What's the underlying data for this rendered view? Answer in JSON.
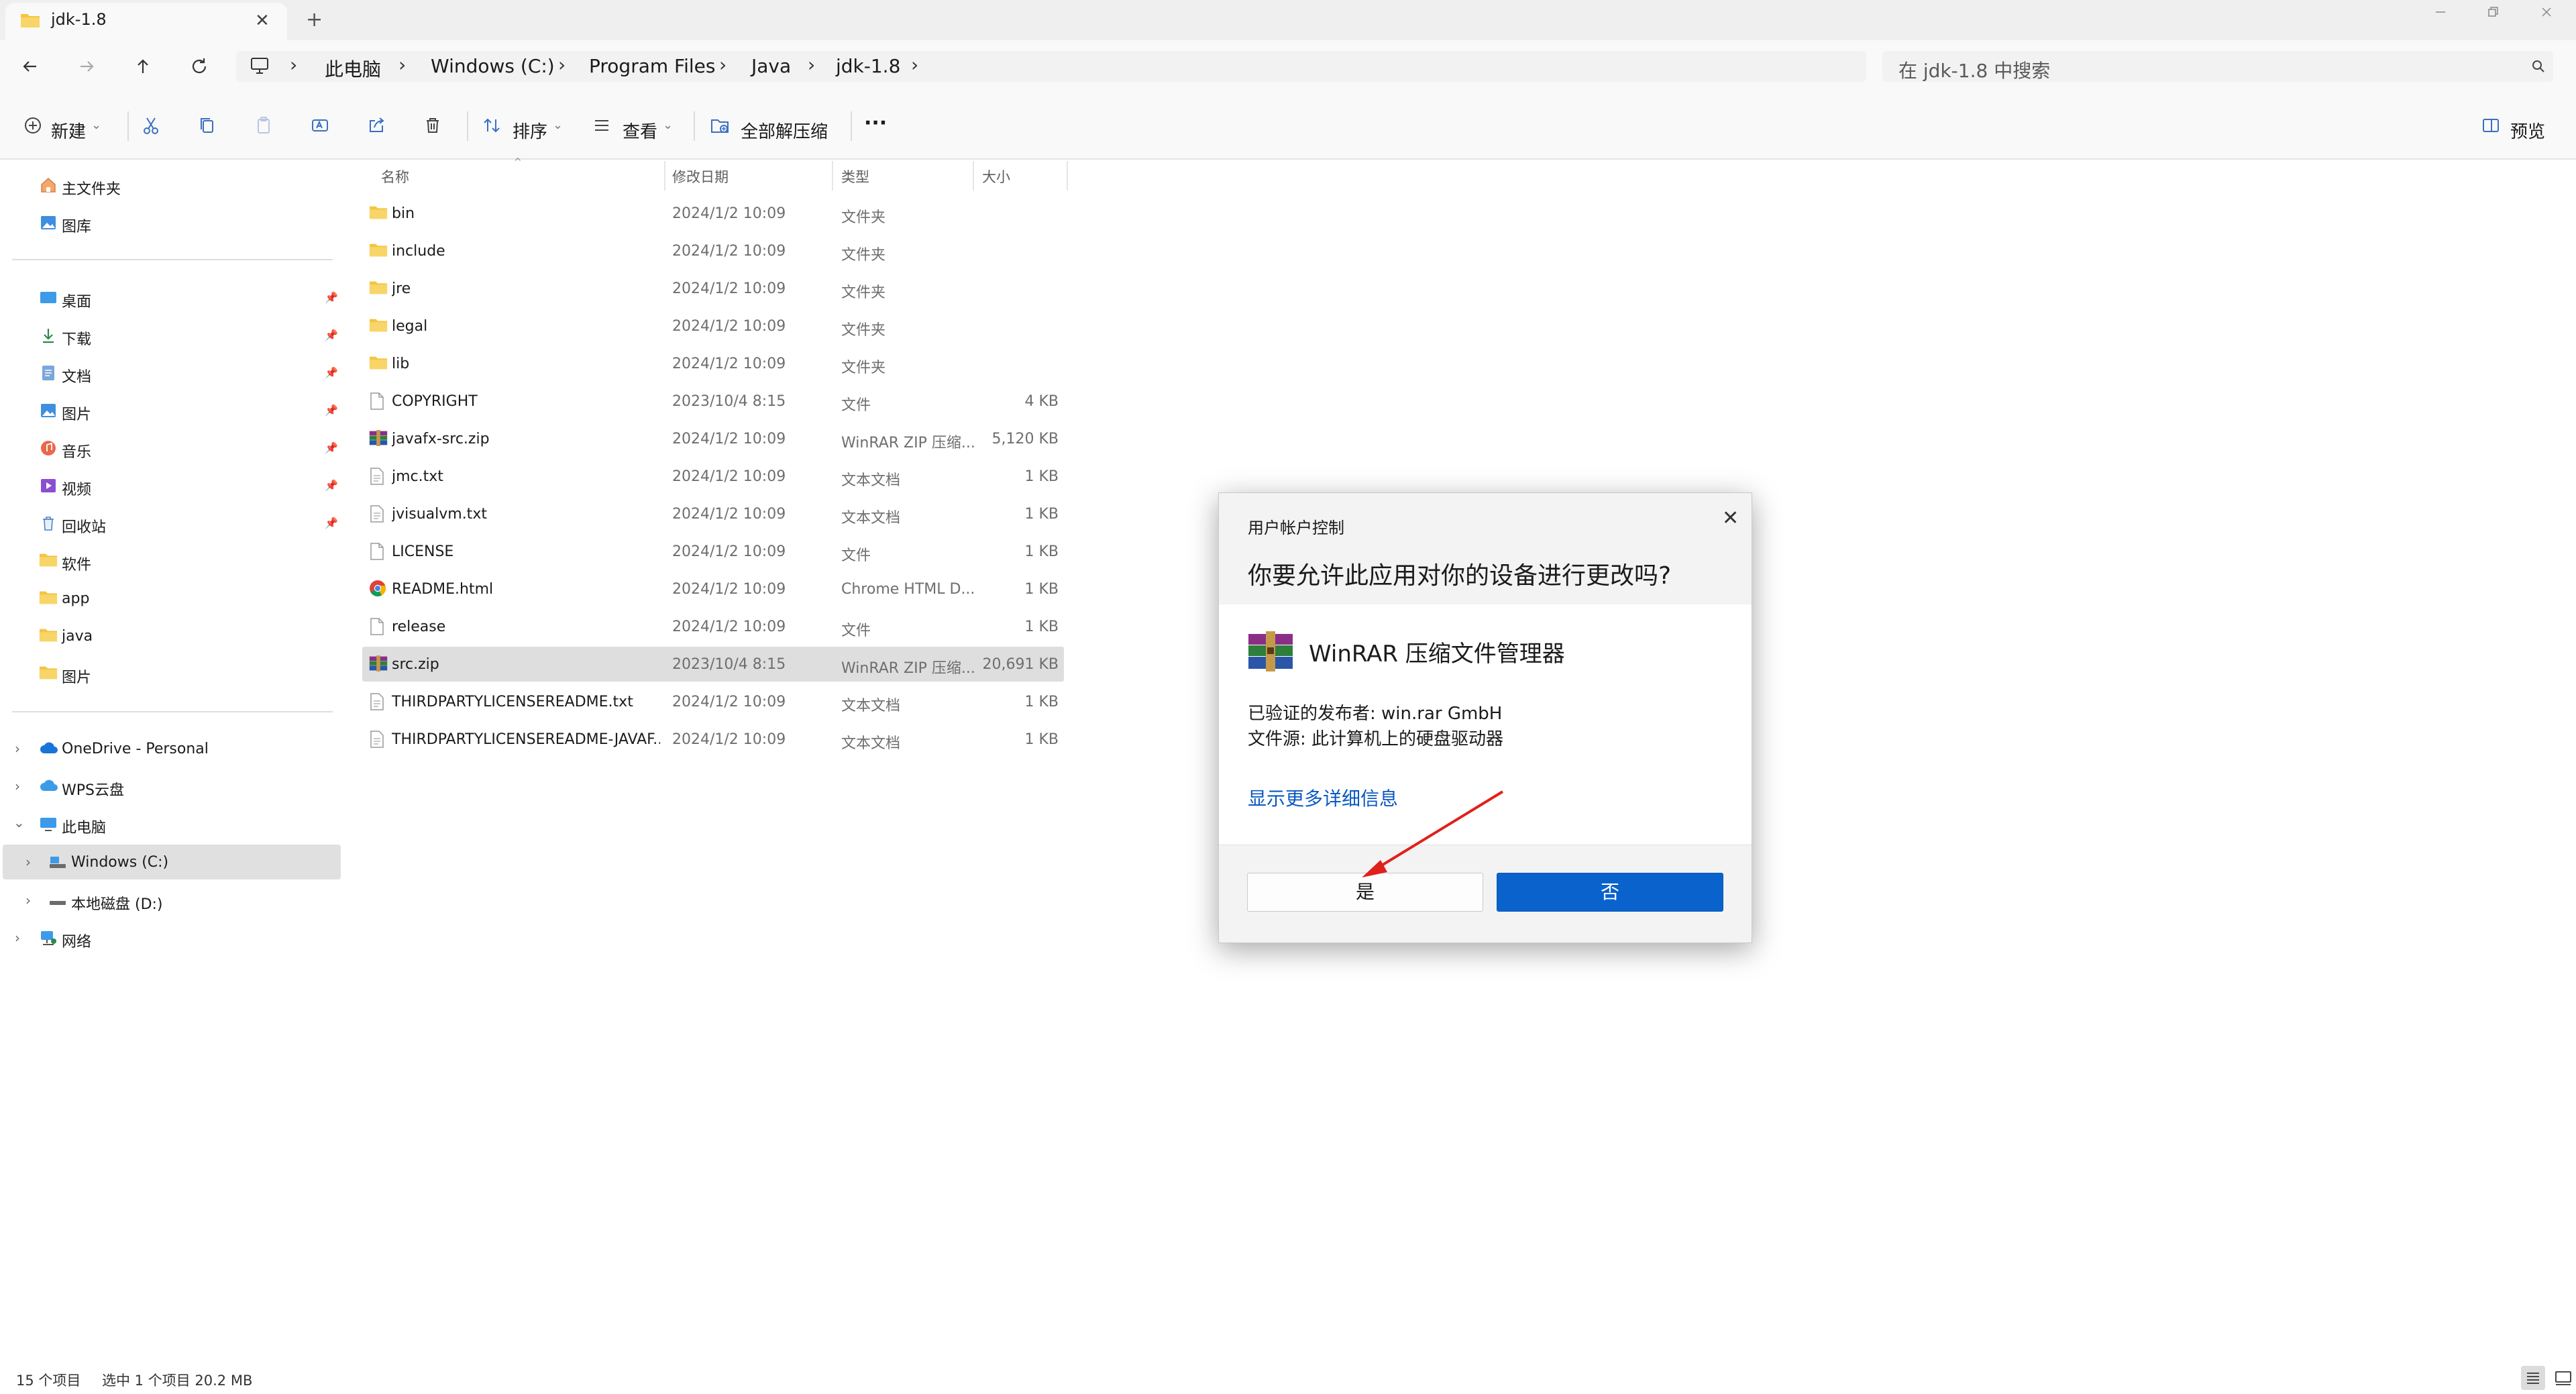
{
  "window": {
    "tab_title": "jdk-1.8",
    "new_tab": "+",
    "close": "✕"
  },
  "address": {
    "crumbs": [
      "此电脑",
      "Windows (C:)",
      "Program Files",
      "Java",
      "jdk-1.8"
    ],
    "search_placeholder": "在 jdk-1.8 中搜索"
  },
  "toolbar": {
    "new_label": "新建",
    "sort_label": "排序",
    "view_label": "查看",
    "extract_all_label": "全部解压缩",
    "more_label": "···",
    "preview_label": "预览"
  },
  "nav": {
    "home": "主文件夹",
    "gallery": "图库",
    "quick": [
      "桌面",
      "下载",
      "文档",
      "图片",
      "音乐",
      "视频",
      "回收站",
      "软件",
      "app",
      "java",
      "图片"
    ],
    "onedrive": "OneDrive - Personal",
    "wps": "WPS云盘",
    "this_pc": "此电脑",
    "drive_c": "Windows (C:)",
    "drive_d": "本地磁盘 (D:)",
    "network": "网络"
  },
  "columns": {
    "name": "名称",
    "modified": "修改日期",
    "type": "类型",
    "size": "大小"
  },
  "files": [
    {
      "name": "bin",
      "modified": "2024/1/2 10:09",
      "type": "文件夹",
      "size": "",
      "icon": "folder-icon"
    },
    {
      "name": "include",
      "modified": "2024/1/2 10:09",
      "type": "文件夹",
      "size": "",
      "icon": "folder-icon"
    },
    {
      "name": "jre",
      "modified": "2024/1/2 10:09",
      "type": "文件夹",
      "size": "",
      "icon": "folder-icon"
    },
    {
      "name": "legal",
      "modified": "2024/1/2 10:09",
      "type": "文件夹",
      "size": "",
      "icon": "folder-icon"
    },
    {
      "name": "lib",
      "modified": "2024/1/2 10:09",
      "type": "文件夹",
      "size": "",
      "icon": "folder-icon"
    },
    {
      "name": "COPYRIGHT",
      "modified": "2023/10/4 8:15",
      "type": "文件",
      "size": "4 KB",
      "icon": "file-icon"
    },
    {
      "name": "javafx-src.zip",
      "modified": "2024/1/2 10:09",
      "type": "WinRAR ZIP 压缩...",
      "size": "5,120 KB",
      "icon": "winrar-icon"
    },
    {
      "name": "jmc.txt",
      "modified": "2024/1/2 10:09",
      "type": "文本文档",
      "size": "1 KB",
      "icon": "text-file-icon"
    },
    {
      "name": "jvisualvm.txt",
      "modified": "2024/1/2 10:09",
      "type": "文本文档",
      "size": "1 KB",
      "icon": "text-file-icon"
    },
    {
      "name": "LICENSE",
      "modified": "2024/1/2 10:09",
      "type": "文件",
      "size": "1 KB",
      "icon": "file-icon"
    },
    {
      "name": "README.html",
      "modified": "2024/1/2 10:09",
      "type": "Chrome HTML D...",
      "size": "1 KB",
      "icon": "chrome-icon"
    },
    {
      "name": "release",
      "modified": "2024/1/2 10:09",
      "type": "文件",
      "size": "1 KB",
      "icon": "file-icon"
    },
    {
      "name": "src.zip",
      "modified": "2023/10/4 8:15",
      "type": "WinRAR ZIP 压缩...",
      "size": "20,691 KB",
      "icon": "winrar-icon",
      "selected": true
    },
    {
      "name": "THIRDPARTYLICENSEREADME.txt",
      "modified": "2024/1/2 10:09",
      "type": "文本文档",
      "size": "1 KB",
      "icon": "text-file-icon"
    },
    {
      "name": "THIRDPARTYLICENSEREADME-JAVAF...",
      "modified": "2024/1/2 10:09",
      "type": "文本文档",
      "size": "1 KB",
      "icon": "text-file-icon"
    }
  ],
  "status": {
    "count": "15 个项目",
    "selection": "选中 1 个项目  20.2 MB"
  },
  "uac": {
    "title": "用户帐户控制",
    "question": "你要允许此应用对你的设备进行更改吗?",
    "app_name": "WinRAR 压缩文件管理器",
    "publisher": "已验证的发布者: win.rar GmbH",
    "origin": "文件源: 此计算机上的硬盘驱动器",
    "more_info": "显示更多详细信息",
    "yes": "是",
    "no": "否"
  },
  "colors": {
    "accent": "#0a63cc",
    "folder": "#f4c542",
    "link": "#0a58c2",
    "annotation_arrow": "#e0201b"
  }
}
